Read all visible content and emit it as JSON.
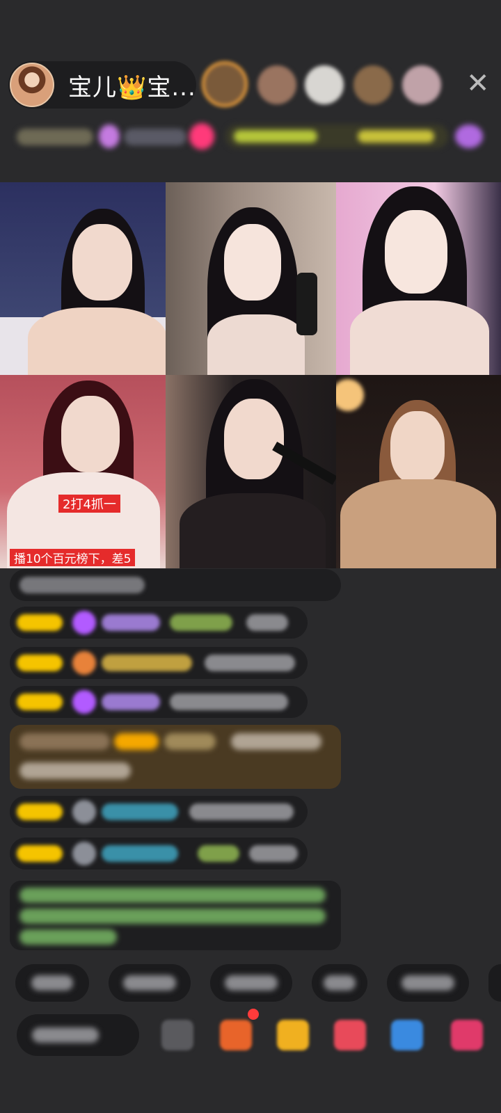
{
  "host": {
    "name": "宝儿👑宝...",
    "avatar_icon": "host-avatar-icon"
  },
  "viewers": [
    {
      "color": "#7a5a3a"
    },
    {
      "color": "#9a7460"
    },
    {
      "color": "#d8d6d2"
    },
    {
      "color": "#8a6a4a"
    },
    {
      "color": "#c0a2a8"
    }
  ],
  "close_icon": "✕",
  "grid": {
    "tiles": [
      {
        "bg": "#3b3f68",
        "label": ""
      },
      {
        "bg": "#9b8a80",
        "label": ""
      },
      {
        "bg": "#d8a3c8",
        "label": ""
      },
      {
        "bg": "#b7545e",
        "label": "2打4抓一"
      },
      {
        "bg": "#2a2425",
        "label": ""
      },
      {
        "bg": "#2f2320",
        "label": ""
      }
    ],
    "banner": "播10个百元榜下，差5"
  },
  "colors": {
    "accent_gold": "#f2a23b",
    "badge_yellow": "#f5c400",
    "purple": "#b25bff",
    "notify_red": "#ff3b3b"
  }
}
